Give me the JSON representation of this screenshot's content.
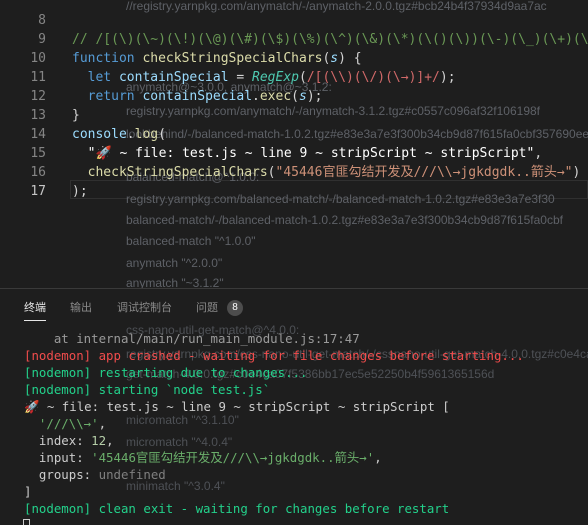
{
  "editor": {
    "line_numbers": [
      "8",
      "9",
      "10",
      "11",
      "12",
      "13",
      "14",
      "15",
      "16",
      "17"
    ],
    "comment_line": "// /[(\\)(\\~)(\\!)(\\@)(\\#)(\\$)(\\%)(\\^)(\\&)(\\*)(\\()(\\))(\\-)(\\_)(\\+)(\\",
    "function_keyword": "function",
    "function_name": "checkStringSpecialChars",
    "param_name": "s",
    "let_keyword": "let",
    "var_name": "containSpecial",
    "regexp_class": "RegExp",
    "regex_literal": "/[(\\\\)(\\/)(\\→)]+/",
    "return_keyword": "return",
    "exec_method": "exec",
    "console_object": "console",
    "log_method": "log",
    "log_string": "\"🚀 ~ file: test.js ~ line 9 ~ stripScript ~ stripScript\"",
    "call_function": "checkStringSpecialChars",
    "call_argument": "\"45446官匪勾结开发及///\\\\→jgkdgdk..箭头→\""
  },
  "overlay_text": [
    "//registry.yarnpkg.com/anymatch/-/anymatch-2.0.0.tgz#bcb24b4f37934d9aa7ac",
    "anymatch@~3.0.0, anymatch@~3.1.2:",
    "registry.yarnpkg.com/anymatch/-/anymatch-3.1.2.tgz#c0557c096af32f106198f",
    "lookbehind/-/balanced-match-1.0.2.tgz#e83e3a7e3f300b34cb9d87f615fa0cbf357690ee2a383",
    "balanced-match@^1.0.0:",
    "registry.yarnpkg.com/balanced-match/-/balanced-match-1.0.2.tgz#e83e3a7e3f30",
    "balanced-match/-/balanced-match-1.0.2.tgz#e83e3a7e3f300b34cb9d87f615fa0cbf",
    "balanced-match \"^1.0.0\"",
    "anymatch \"^2.0.0\"",
    "anymatch \"~3.1.2\"",
    "css-nano-util-get-match@^4.0.0:",
    "registry.yarnpkg.com/css-nano-util-get-match/-/cssnano-util-get-match-4.0.0.tgz#c0e4ca",
    "get-match-4.0.0.tgz#c0e4ca07f5386bb17ec5e52250b4f5961365156d",
    "micromatch \"^3.1.10\"",
    "micromatch \"^4.0.4\"",
    "minimatch \"^3.0.4\""
  ],
  "panel": {
    "tabs": [
      "终端",
      "输出",
      "调试控制台",
      "问题"
    ],
    "problems_count": "8"
  },
  "terminal": {
    "l0_text": "    at internal/main/run_main_module.js:17:47",
    "l1_text": "[nodemon] app crashed - waiting for file changes before starting...",
    "l2_text": "[nodemon] restarting due to changes...",
    "l3_text": "[nodemon] starting `node test.js`",
    "l4_text": "🚀 ~ file: test.js ~ line 9 ~ stripScript ~ stripScript [",
    "l5_str": "  '///\\\\→'",
    "l5_comma": ",",
    "l6_key": "  index: ",
    "l6_val": "12",
    "l6_comma": ",",
    "l7_key": "  input: ",
    "l7_val": "'45446官匪勾结开发及///\\\\→jgkdgdk..箭头→'",
    "l7_comma": ",",
    "l8_key": "  groups: ",
    "l8_val": "undefined",
    "l9_text": "]",
    "l10_text": "[nodemon] clean exit - waiting for changes before restart"
  },
  "colors": {
    "editor_bg": "#1e1e1e",
    "keyword": "#569cd6",
    "function": "#dcdcaa",
    "string": "#ce9178",
    "regex": "#d16969",
    "error_red": "#f14c4c",
    "success_green": "#23d18b"
  }
}
